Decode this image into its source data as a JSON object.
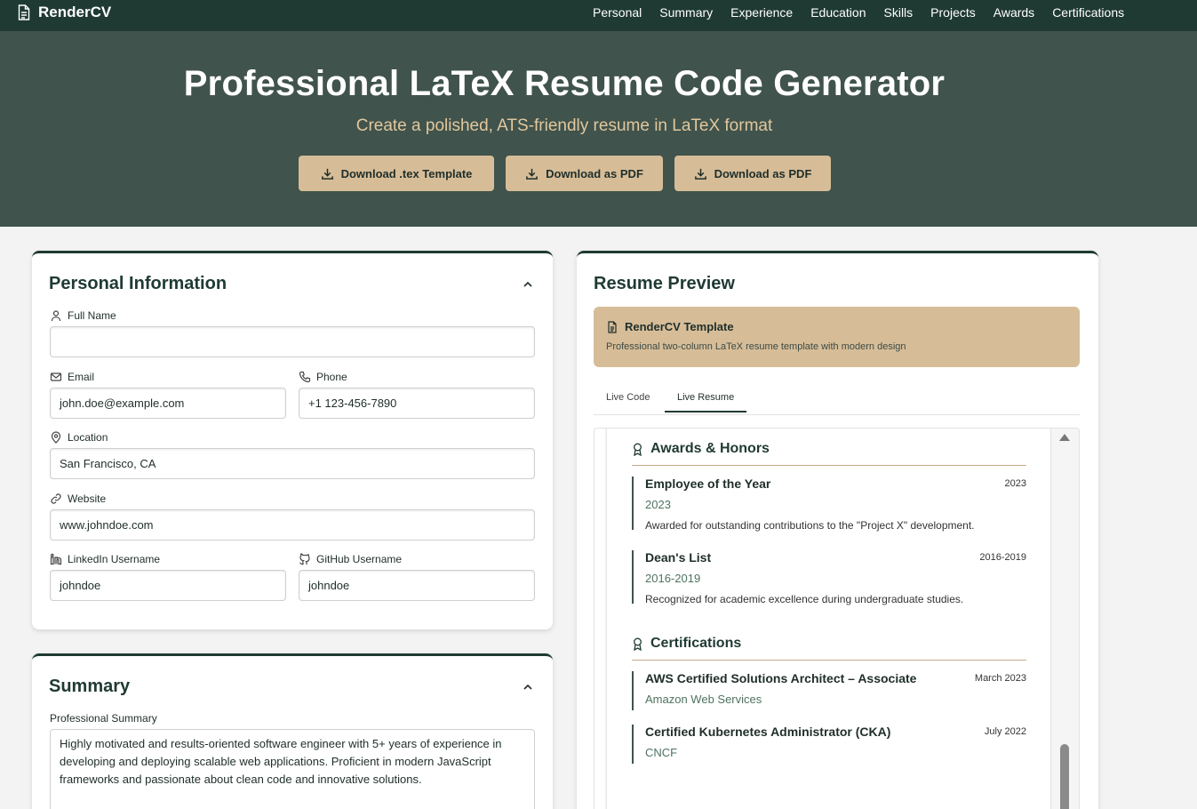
{
  "nav": {
    "brand": "RenderCV",
    "links": [
      "Personal",
      "Summary",
      "Experience",
      "Education",
      "Skills",
      "Projects",
      "Awards",
      "Certifications"
    ]
  },
  "hero": {
    "title": "Professional LaTeX Resume Code Generator",
    "subtitle": "Create a polished, ATS-friendly resume in LaTeX format",
    "buttons": [
      "Download .tex Template",
      "Download as PDF",
      "Download as PDF"
    ]
  },
  "personal": {
    "title": "Personal Information",
    "full_name": {
      "label": "Full Name",
      "value": ""
    },
    "email": {
      "label": "Email",
      "value": "john.doe@example.com"
    },
    "phone": {
      "label": "Phone",
      "value": "+1 123-456-7890"
    },
    "location": {
      "label": "Location",
      "value": "San Francisco, CA"
    },
    "website": {
      "label": "Website",
      "value": "www.johndoe.com"
    },
    "linkedin": {
      "label": "LinkedIn Username",
      "value": "johndoe"
    },
    "github": {
      "label": "GitHub Username",
      "value": "johndoe"
    }
  },
  "summary": {
    "title": "Summary",
    "label": "Professional Summary",
    "value": "Highly motivated and results-oriented software engineer with 5+ years of experience in developing and deploying scalable web applications. Proficient in modern JavaScript frameworks and passionate about clean code and innovative solutions."
  },
  "preview": {
    "title": "Resume Preview",
    "template_name": "RenderCV Template",
    "template_desc": "Professional two-column LaTeX resume template with modern design",
    "tabs": [
      "Live Code",
      "Live Resume"
    ],
    "active_tab": "Live Resume",
    "awards_heading": "Awards & Honors",
    "awards": [
      {
        "title": "Employee of the Year",
        "date": "2023",
        "sub": "2023",
        "desc": "Awarded for outstanding contributions to the \"Project X\" development."
      },
      {
        "title": "Dean's List",
        "date": "2016-2019",
        "sub": "2016-2019",
        "desc": "Recognized for academic excellence during undergraduate studies."
      }
    ],
    "certs_heading": "Certifications",
    "certs": [
      {
        "title": "AWS Certified Solutions Architect – Associate",
        "date": "March 2023",
        "sub": "Amazon Web Services"
      },
      {
        "title": "Certified Kubernetes Administrator (CKA)",
        "date": "July 2022",
        "sub": "CNCF"
      }
    ]
  },
  "colors": {
    "nav_bg": "#1f3a33",
    "hero_bg": "#40534c",
    "accent": "#d6bd98",
    "subtitle": "#e2c79d"
  }
}
